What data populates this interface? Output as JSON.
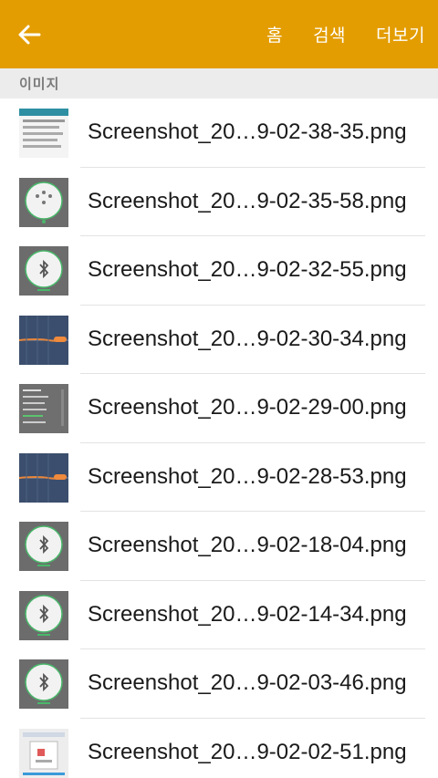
{
  "appbar": {
    "back_icon": "arrow-left-icon",
    "actions": [
      {
        "label": "홈"
      },
      {
        "label": "검색"
      },
      {
        "label": "더보기"
      }
    ]
  },
  "section": {
    "title": "이미지"
  },
  "files": [
    {
      "name": "Screenshot_20…9-02-38-35.png",
      "thumb": "light-app-list"
    },
    {
      "name": "Screenshot_20…9-02-35-58.png",
      "thumb": "grey-circle-icons"
    },
    {
      "name": "Screenshot_20…9-02-32-55.png",
      "thumb": "grey-circle-bluetooth"
    },
    {
      "name": "Screenshot_20…9-02-30-34.png",
      "thumb": "dark-blue-chart"
    },
    {
      "name": "Screenshot_20…9-02-29-00.png",
      "thumb": "grey-text-list"
    },
    {
      "name": "Screenshot_20…9-02-28-53.png",
      "thumb": "dark-blue-chart"
    },
    {
      "name": "Screenshot_20…9-02-18-04.png",
      "thumb": "grey-circle-bluetooth"
    },
    {
      "name": "Screenshot_20…9-02-14-34.png",
      "thumb": "grey-circle-bluetooth"
    },
    {
      "name": "Screenshot_20…9-02-03-46.png",
      "thumb": "grey-circle-bluetooth"
    },
    {
      "name": "Screenshot_20…9-02-02-51.png",
      "thumb": "light-dialog"
    }
  ],
  "colors": {
    "appbar": "#e39d00",
    "section_bg": "#ececec",
    "text": "#1a1a1a"
  }
}
